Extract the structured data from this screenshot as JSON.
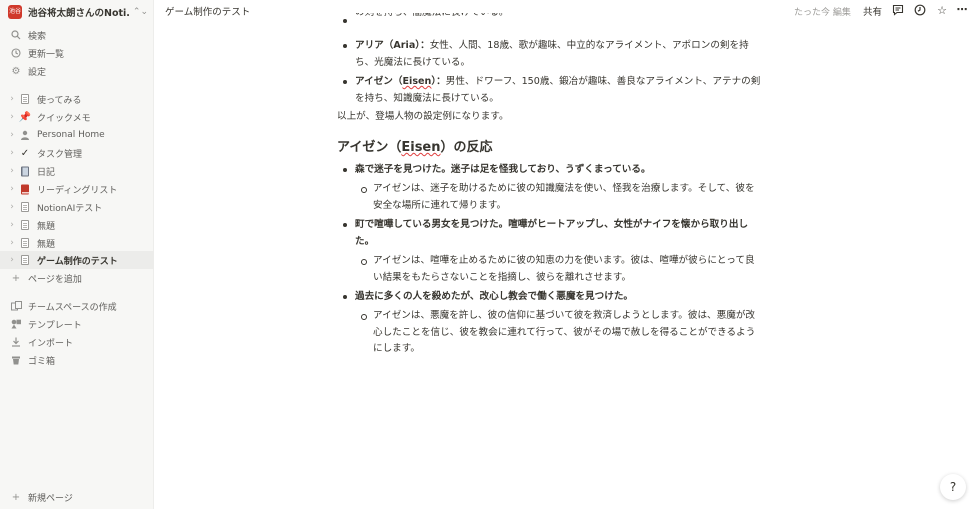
{
  "workspace": {
    "badge": "池谷",
    "name": "池谷将太朗さんのNoti...",
    "switch_icon": "⌃⌄"
  },
  "sidebar": {
    "top_items": [
      {
        "icon": "search-icon",
        "label": "検索"
      },
      {
        "icon": "clock-icon",
        "label": "更新一覧"
      },
      {
        "icon": "gear-icon",
        "label": "設定"
      }
    ],
    "pages": [
      {
        "icon": "page-icon",
        "label": "使ってみる"
      },
      {
        "icon": "pin-icon",
        "label": "クイックメモ"
      },
      {
        "icon": "person-icon",
        "label": "Personal Home"
      },
      {
        "icon": "checkmark-icon",
        "label": "タスク管理"
      },
      {
        "icon": "notebook-icon",
        "label": "日記"
      },
      {
        "icon": "book-icon",
        "label": "リーディングリスト"
      },
      {
        "icon": "page-icon",
        "label": "NotionAIテスト"
      },
      {
        "icon": "page-icon",
        "label": "無題"
      },
      {
        "icon": "page-icon",
        "label": "無題"
      },
      {
        "icon": "page-icon",
        "label": "ゲーム制作のテスト"
      }
    ],
    "add_page": "ページを追加",
    "bottom_items": [
      {
        "icon": "teamspace-icon",
        "label": "チームスペースの作成"
      },
      {
        "icon": "template-icon",
        "label": "テンプレート"
      },
      {
        "icon": "import-icon",
        "label": "インポート"
      },
      {
        "icon": "trash-icon",
        "label": "ゴミ箱"
      }
    ],
    "new_page": "新規ページ"
  },
  "topbar": {
    "breadcrumb": "ゲーム制作のテスト",
    "edited": "たった今 編集",
    "share": "共有"
  },
  "content": {
    "line0": "の剣を持ち、闇魔法に長けている。",
    "aria_name": "アリア（Aria）：",
    "aria_desc_1": "女性、人間、18歳、歌が趣味、中立的なアライメント、アポロンの剣を持",
    "aria_desc_2": "ち、光魔法に長けている。",
    "eisen_name_1": "アイゼン（",
    "eisen_name_2": "Eisen",
    "eisen_name_3": "）：",
    "eisen_desc_1": "男性、ドワーフ、150歳、鍛冶が趣味、善良なアライメント、アテナの剣",
    "eisen_desc_2": "を持ち、知識魔法に長けている。",
    "summary": "以上が、登場人物の設定例になります。",
    "heading_1": "アイゼン（",
    "heading_2": "Eisen",
    "heading_3": "）の反応",
    "s1_title": "森で迷子を見つけた。迷子は足を怪我しており、うずくまっている。",
    "s1_r1": "アイゼンは、迷子を助けるために彼の知識魔法を使い、怪我を治療します。そして、彼を",
    "s1_r2": "安全な場所に連れて帰ります。",
    "s2_t1": "町で喧嘩している男女を見つけた。喧嘩がヒートアップし、女性がナイフを懐から取り出し",
    "s2_t2": "た。",
    "s2_r1": "アイゼンは、喧嘩を止めるために彼の知恵の力を使います。彼は、喧嘩が彼らにとって良",
    "s2_r2": "い結果をもたらさないことを指摘し、彼らを離れさせます。",
    "s3_title": "過去に多くの人を殺めたが、改心し教会で働く悪魔を見つけた。",
    "s3_r1": "アイゼンは、悪魔を許し、彼の信仰に基づいて彼を救済しようとします。彼は、悪魔が改",
    "s3_r2": "心したことを信じ、彼を教会に連れて行って、彼がその場で赦しを得ることができるよう",
    "s3_r3": "にします。"
  },
  "help_label": "?"
}
